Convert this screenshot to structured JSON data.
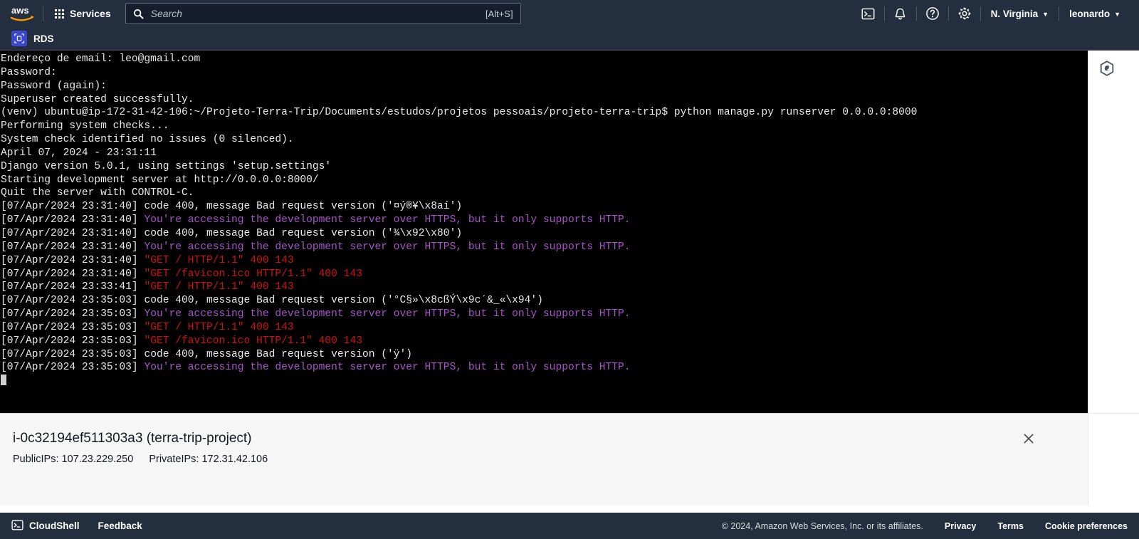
{
  "topnav": {
    "logo_alt": "aws",
    "services_label": "Services",
    "search": {
      "value": "",
      "placeholder": "Search",
      "hint": "[Alt+S]"
    },
    "icons": [
      "cloudshell-icon",
      "bell-icon",
      "help-icon",
      "settings-icon"
    ],
    "region": "N. Virginia",
    "account": "leonardo",
    "caret": "▼"
  },
  "service_bar": {
    "service_name": "RDS",
    "icon": "rds-icon"
  },
  "terminal": {
    "lines": [
      {
        "segments": [
          {
            "text": "Endereço de email: leo@gmail.com",
            "color": "white"
          }
        ]
      },
      {
        "segments": [
          {
            "text": "Password:",
            "color": "white"
          }
        ]
      },
      {
        "segments": [
          {
            "text": "Password (again):",
            "color": "white"
          }
        ]
      },
      {
        "segments": [
          {
            "text": "Superuser created successfully.",
            "color": "white"
          }
        ]
      },
      {
        "segments": [
          {
            "text": "(venv) ubuntu@ip-172-31-42-106:~/Projeto-Terra-Trip/Documents/estudos/projetos pessoais/projeto-terra-trip$ python manage.py runserver 0.0.0.0:8000",
            "color": "white"
          }
        ]
      },
      {
        "segments": [
          {
            "text": "Performing system checks...",
            "color": "white"
          }
        ]
      },
      {
        "segments": [
          {
            "text": "",
            "color": "white"
          }
        ]
      },
      {
        "segments": [
          {
            "text": "System check identified no issues (0 silenced).",
            "color": "white"
          }
        ]
      },
      {
        "segments": [
          {
            "text": "April 07, 2024 - 23:31:11",
            "color": "white"
          }
        ]
      },
      {
        "segments": [
          {
            "text": "Django version 5.0.1, using settings 'setup.settings'",
            "color": "white"
          }
        ]
      },
      {
        "segments": [
          {
            "text": "Starting development server at http://0.0.0.0:8000/",
            "color": "white"
          }
        ]
      },
      {
        "segments": [
          {
            "text": "Quit the server with CONTROL-C.",
            "color": "white"
          }
        ]
      },
      {
        "segments": [
          {
            "text": "",
            "color": "white"
          }
        ]
      },
      {
        "segments": [
          {
            "text": "[07/Apr/2024 23:31:40] ",
            "color": "white"
          },
          {
            "text": "code 400, message Bad request version ('¤ý®¥\\x8aí')",
            "color": "white"
          }
        ]
      },
      {
        "segments": [
          {
            "text": "[07/Apr/2024 23:31:40] ",
            "color": "white"
          },
          {
            "text": "You're accessing the development server over HTTPS, but it only supports HTTP.",
            "color": "magenta"
          }
        ]
      },
      {
        "segments": [
          {
            "text": "[07/Apr/2024 23:31:40] ",
            "color": "white"
          },
          {
            "text": "code 400, message Bad request version ('¾\\x92\\x80')",
            "color": "white"
          }
        ]
      },
      {
        "segments": [
          {
            "text": "[07/Apr/2024 23:31:40] ",
            "color": "white"
          },
          {
            "text": "You're accessing the development server over HTTPS, but it only supports HTTP.",
            "color": "magenta"
          }
        ]
      },
      {
        "segments": [
          {
            "text": "[07/Apr/2024 23:31:40] ",
            "color": "white"
          },
          {
            "text": "\"GET / HTTP/1.1\" 400 143",
            "color": "red"
          }
        ]
      },
      {
        "segments": [
          {
            "text": "[07/Apr/2024 23:31:40] ",
            "color": "white"
          },
          {
            "text": "\"GET /favicon.ico HTTP/1.1\" 400 143",
            "color": "red"
          }
        ]
      },
      {
        "segments": [
          {
            "text": "[07/Apr/2024 23:33:41] ",
            "color": "white"
          },
          {
            "text": "\"GET / HTTP/1.1\" 400 143",
            "color": "red"
          }
        ]
      },
      {
        "segments": [
          {
            "text": "[07/Apr/2024 23:35:03] ",
            "color": "white"
          },
          {
            "text": "code 400, message Bad request version ('°C§»\\x8cßÝ\\x9c´&_«\\x94')",
            "color": "white"
          }
        ]
      },
      {
        "segments": [
          {
            "text": "[07/Apr/2024 23:35:03] ",
            "color": "white"
          },
          {
            "text": "You're accessing the development server over HTTPS, but it only supports HTTP.",
            "color": "magenta"
          }
        ]
      },
      {
        "segments": [
          {
            "text": "[07/Apr/2024 23:35:03] ",
            "color": "white"
          },
          {
            "text": "\"GET / HTTP/1.1\" 400 143",
            "color": "red"
          }
        ]
      },
      {
        "segments": [
          {
            "text": "[07/Apr/2024 23:35:03] ",
            "color": "white"
          },
          {
            "text": "\"GET /favicon.ico HTTP/1.1\" 400 143",
            "color": "red"
          }
        ]
      },
      {
        "segments": [
          {
            "text": "[07/Apr/2024 23:35:03] ",
            "color": "white"
          },
          {
            "text": "code 400, message Bad request version ('ÿ')",
            "color": "white"
          }
        ]
      },
      {
        "segments": [
          {
            "text": "[07/Apr/2024 23:35:03] ",
            "color": "white"
          },
          {
            "text": "You're accessing the development server over HTTPS, but it only supports HTTP.",
            "color": "magenta"
          }
        ]
      },
      {
        "segments": [
          {
            "text": "",
            "color": "white"
          },
          {
            "cursor": true
          }
        ]
      }
    ],
    "colors": {
      "white": "#e9e9e9",
      "magenta": "#a855c8",
      "red": "#cf1111",
      "background": "#000000"
    }
  },
  "tools_rail": {
    "icon": "aws-tools-hex-icon"
  },
  "info_panel": {
    "title": "i-0c32194ef511303a3 (terra-trip-project)",
    "public_ips_label": "PublicIPs:",
    "public_ips": "107.23.229.250",
    "private_ips_label": "PrivateIPs:",
    "private_ips": "172.31.42.106",
    "close_label": "✕"
  },
  "footer": {
    "cloudshell": "CloudShell",
    "feedback": "Feedback",
    "copyright": "© 2024, Amazon Web Services, Inc. or its affiliates.",
    "links": [
      "Privacy",
      "Terms",
      "Cookie preferences"
    ]
  }
}
